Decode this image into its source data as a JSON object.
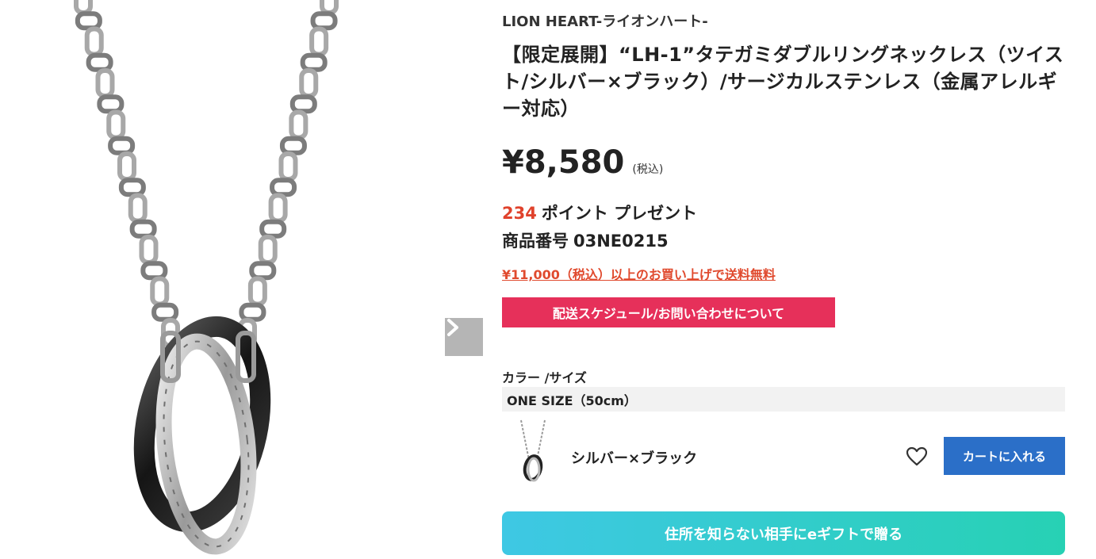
{
  "product": {
    "brand": "LION HEART-ライオンハート-",
    "title": "【限定展開】“LH-1”タテガミダブルリングネックレス（ツイスト/シルバー×ブラック）/サージカルステンレス（金属アレルギー対応）",
    "price": "¥8,580",
    "tax_note": "(税込)",
    "points_value": "234",
    "points_label": "ポイント プレゼント",
    "code_label": "商品番号",
    "code_value": "03NE0215"
  },
  "shipping_notice": "¥11,000（税込）以上のお買い上げで送料無料",
  "schedule_button": "配送スケジュール/お問い合わせについて",
  "variants": {
    "label": "カラー /サイズ",
    "size": "ONE SIZE（50cm）",
    "color": "シルバー×ブラック",
    "cart_button": "カートに入れる"
  },
  "gift_button": "住所を知らない相手にeギフトで贈る",
  "icons": {
    "next": "chevron-right-icon",
    "favorite": "heart-icon"
  },
  "colors": {
    "accent_red": "#e0422c",
    "schedule_bg": "#e6305a",
    "cart_bg": "#2b6fc8",
    "gift_gradient_start": "#3ec8e4",
    "gift_gradient_end": "#27d1b4"
  }
}
